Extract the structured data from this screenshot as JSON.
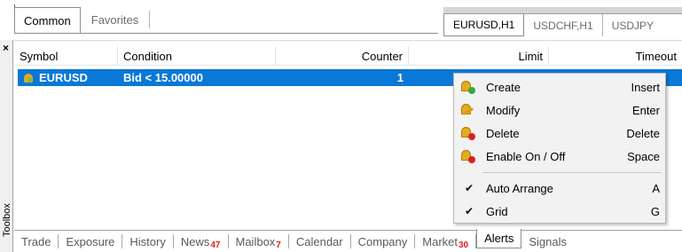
{
  "nav_tabs": [
    {
      "label": "Common",
      "active": true
    },
    {
      "label": "Favorites",
      "active": false
    }
  ],
  "chart_tabs": [
    {
      "label": "EURUSD,H1",
      "active": true
    },
    {
      "label": "USDCHF,H1",
      "active": false
    },
    {
      "label": "USDJPY",
      "active": false
    }
  ],
  "toolbox": {
    "title": "Toolbox",
    "close_glyph": "×"
  },
  "alerts_table": {
    "columns": [
      "Symbol",
      "Condition",
      "Counter",
      "Limit",
      "Timeout"
    ],
    "rows": [
      {
        "symbol": "EURUSD",
        "condition": "Bid < 15.00000",
        "counter": "1",
        "selected": true,
        "icon": "alert-enabled-icon"
      }
    ]
  },
  "context_menu": {
    "items": [
      {
        "label": "Create",
        "shortcut": "Insert",
        "icon": "alert-create-icon"
      },
      {
        "label": "Modify",
        "shortcut": "Enter",
        "icon": "alert-modify-icon"
      },
      {
        "label": "Delete",
        "shortcut": "Delete",
        "icon": "alert-delete-icon"
      },
      {
        "label": "Enable On / Off",
        "shortcut": "Space",
        "icon": "alert-toggle-icon"
      },
      {
        "label": "Auto Arrange",
        "shortcut": "A",
        "checked": true
      },
      {
        "label": "Grid",
        "shortcut": "G",
        "checked": true
      }
    ],
    "check_glyph": "✔"
  },
  "bottom_tabs": [
    {
      "label": "Trade"
    },
    {
      "label": "Exposure"
    },
    {
      "label": "History"
    },
    {
      "label": "News",
      "count": "47"
    },
    {
      "label": "Mailbox",
      "count": "7"
    },
    {
      "label": "Calendar"
    },
    {
      "label": "Company"
    },
    {
      "label": "Market",
      "count": "30"
    },
    {
      "label": "Alerts",
      "active": true
    },
    {
      "label": "Signals"
    }
  ],
  "colors": {
    "selection": "#0a78d7",
    "count_badge": "#e02020",
    "menu_bg": "#f2f2f2"
  }
}
